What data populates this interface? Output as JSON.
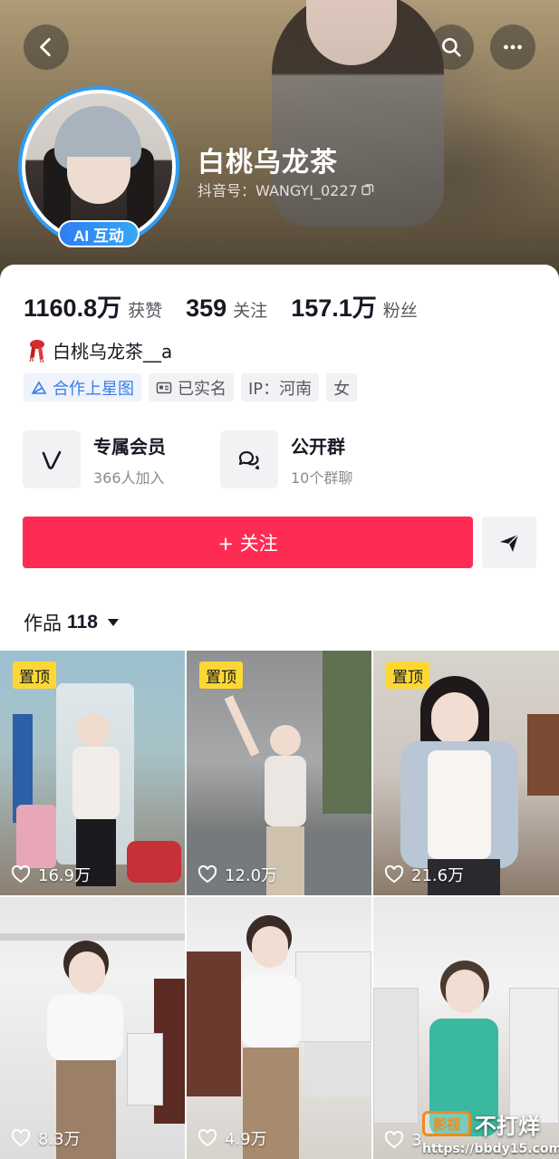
{
  "header": {
    "nickname": "白桃乌龙茶",
    "douyin_id": "抖音号：WANGYI_0227",
    "ai_badge": "AI 互动"
  },
  "stats": [
    {
      "value": "1160.8万",
      "label": "获赞"
    },
    {
      "value": "359",
      "label": "关注"
    },
    {
      "value": "157.1万",
      "label": "粉丝"
    }
  ],
  "bio": "白桃乌龙茶__a",
  "tags": [
    {
      "label": "合作上星图",
      "icon": "star-map-icon"
    },
    {
      "label": "已实名",
      "icon": "id-card-icon"
    },
    {
      "label": "IP：河南",
      "icon": ""
    },
    {
      "label": "女",
      "icon": ""
    }
  ],
  "features": [
    {
      "title": "专属会员",
      "subtitle": "366人加入",
      "icon": "v-member-icon"
    },
    {
      "title": "公开群",
      "subtitle": "10个群聊",
      "icon": "chat-group-icon"
    }
  ],
  "actions": {
    "follow_label": "+ 关注",
    "share_icon": "send-icon"
  },
  "works": {
    "label": "作品",
    "count": "118"
  },
  "grid": {
    "pinned_label": "置顶",
    "items": [
      {
        "likes": "16.9万",
        "pinned": true
      },
      {
        "likes": "12.0万",
        "pinned": true
      },
      {
        "likes": "21.6万",
        "pinned": true
      },
      {
        "likes": "8.3万",
        "pinned": false
      },
      {
        "likes": "4.9万",
        "pinned": false
      },
      {
        "likes": "3",
        "pinned": false
      }
    ]
  },
  "watermark": {
    "box": "影视",
    "text": "不打烊",
    "url": "https://bbdy15.com"
  },
  "colors": {
    "accent": "#fe2c55",
    "pin": "#fdd835",
    "avatar_ring": "#2f9cf2",
    "tag_blue": "#3a7ee6"
  }
}
